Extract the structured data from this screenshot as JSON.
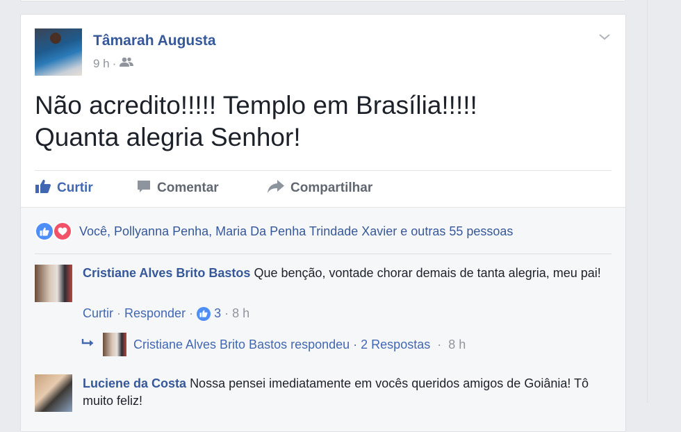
{
  "post": {
    "author": "Tâmarah Augusta",
    "time": "9 h",
    "separator": "·",
    "audience_icon": "friends-icon",
    "text_line1": "Não acredito!!!!! Templo em Brasília!!!!!",
    "text_line2": "Quanta alegria Senhor!"
  },
  "actions": {
    "like": "Curtir",
    "comment": "Comentar",
    "share": "Compartilhar"
  },
  "reactions": {
    "icons": [
      "like-reaction-icon",
      "love-reaction-icon"
    ],
    "text": "Você, Pollyanna Penha, Maria Da Penha Trindade Xavier e outras 55 pessoas"
  },
  "comments": [
    {
      "author": "Cristiane Alves Brito Bastos",
      "text": "Que benção, vontade chorar demais de tanta alegria, meu pai!",
      "like_label": "Curtir",
      "reply_label": "Responder",
      "likes": "3",
      "time": "8 h",
      "reply_summary": "Cristiane Alves Brito Bastos respondeu · 2 Respostas",
      "reply_time": "8 h"
    },
    {
      "author": "Luciene da Costa",
      "text": "Nossa pensei imediatamente em vocês queridos amigos de Goiânia! Tô muito feliz!"
    }
  ],
  "colors": {
    "link": "#365899",
    "action_blue": "#4267b2",
    "muted": "#90949c",
    "background": "#e9ebee"
  }
}
